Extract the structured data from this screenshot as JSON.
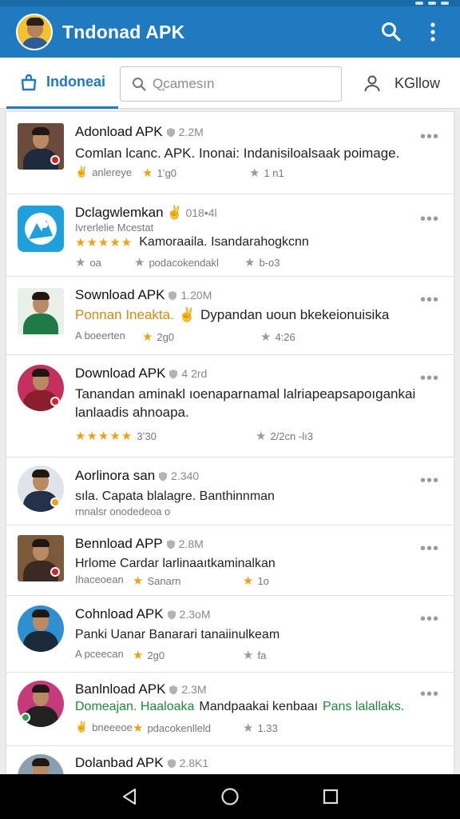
{
  "app_bar": {
    "title": "Tndonad APK"
  },
  "tabs": {
    "home_label": "Indoneai",
    "search_placeholder": "Q̧camesın",
    "follow_label": "KGllow"
  },
  "items": [
    {
      "title": "Adonload APK",
      "size": "2.2M",
      "desc": "Comlan lcanc. APK. Inonai: Indanisiloalsaak poimage.",
      "meta1": "anlereye",
      "meta2": "1ʼg0",
      "meta3": "1 n1"
    },
    {
      "title": "Dclagwlemkan",
      "size": "018•4l",
      "sub": "Ivrerlelie Mcestat",
      "desc": "Kamoraaila. Isandarahogkcnn",
      "meta1": "oa",
      "meta2": "podacokendakl",
      "meta3": "b-o3"
    },
    {
      "title": "Sownload APK",
      "size": "1.20M",
      "desc": "Ponnan Ineakta.",
      "desc2": "Dypandan uoun bkekeionuisika",
      "meta1": "A boeerten",
      "meta2": "2g0",
      "meta3": "4:26"
    },
    {
      "title": "Download APK",
      "size": "4 2rd",
      "desc": "Tanandan aminakl ıoenaparnamal lalriapeapsapoıgankai lanlaadis ahnoapa.",
      "meta2": "3ʼ30",
      "meta3": "2/2cn -lı3"
    },
    {
      "title": "Aorlinora san",
      "size": "2.340",
      "desc": "sıla. Capata blalagre. Banthinnman",
      "sub": "rnnalsr onodedeoa o"
    },
    {
      "title": "Bennload APP",
      "size": "2.8M",
      "desc": "Hrlome Cardar larlinaaıtkaminalkan",
      "meta1": "Ihaceoean",
      "meta2": "Sanarn",
      "meta3": "1o"
    },
    {
      "title": "Cohnload APK",
      "size": "2.3oM",
      "desc": "Panki Uanar Banarari tanaiinulkeam",
      "meta1": "A pceecan",
      "meta2": "2g0",
      "meta3": "fa"
    },
    {
      "title": "Banlnload APK",
      "size": "2.3M",
      "desc": "Domeajan. Haaloaka",
      "desc2": "Mandpaakai kenbaaı",
      "desc3": "Pans lalallaks.",
      "meta1": "bneeeoe",
      "meta2": "pdacokenlleld",
      "meta3": "1.33"
    },
    {
      "title": "Dolanbad APK",
      "size": "2.8K1"
    }
  ],
  "colors": {
    "primary": "#1f7ac0",
    "star": "#f0a216",
    "nav": "#000000"
  }
}
